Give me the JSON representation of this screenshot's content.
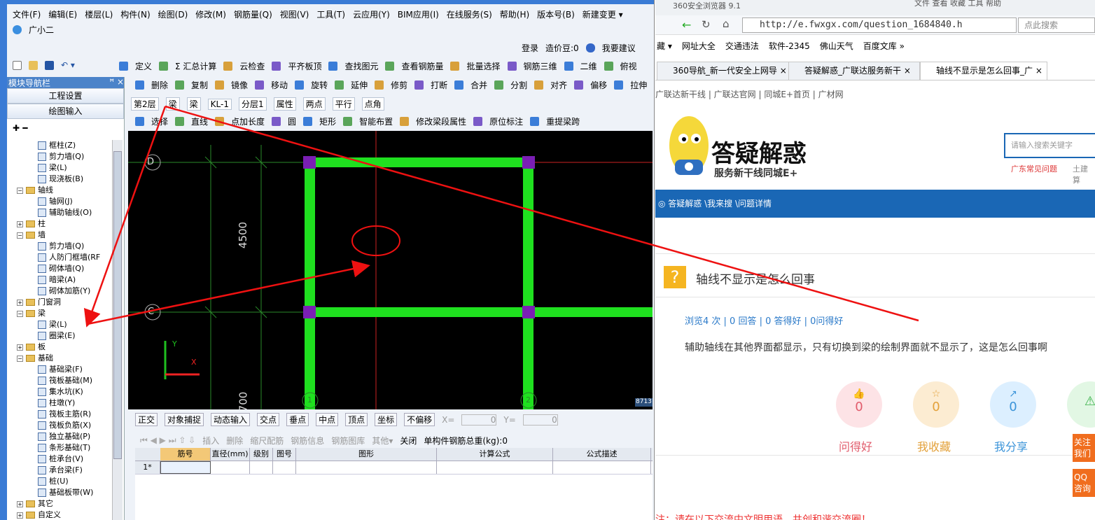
{
  "left": {
    "menu": [
      "文件(F)",
      "编辑(E)",
      "楼层(L)",
      "构件(N)",
      "绘图(D)",
      "修改(M)",
      "钢筋量(Q)",
      "视图(V)",
      "工具(T)",
      "云应用(Y)",
      "BIM应用(I)",
      "在线服务(S)",
      "帮助(H)",
      "版本号(B)",
      "新建变更 ▾"
    ],
    "assistant": "广小二",
    "login": "登录",
    "bean": "造价豆:0",
    "suggest": "我要建议",
    "toolbar1": [
      "定义",
      "Σ 汇总计算",
      "云检查",
      "平齐板顶",
      "查找图元",
      "查看钢筋量",
      "批量选择",
      "钢筋三维",
      "二维",
      "俯视"
    ],
    "toolbar2": [
      "删除",
      "复制",
      "镜像",
      "移动",
      "旋转",
      "延伸",
      "修剪",
      "打断",
      "合并",
      "分割",
      "对齐",
      "偏移",
      "拉伸"
    ],
    "toolbar3": [
      "第2层",
      "梁",
      "梁",
      "KL-1",
      "分层1",
      "属性",
      "两点",
      "平行",
      "点角"
    ],
    "toolbar4": [
      "选择",
      "直线",
      "点加长度",
      "圆",
      "矩形",
      "智能布置",
      "修改梁段属性",
      "原位标注",
      "重提梁跨"
    ],
    "nav_title": "模块导航栏",
    "nav_pin": "ꟸ ×",
    "nav_btn1": "工程设置",
    "nav_btn2": "绘图输入",
    "tree": [
      {
        "t": "框柱(Z)",
        "lv": 2
      },
      {
        "t": "剪力墙(Q)",
        "lv": 2
      },
      {
        "t": "梁(L)",
        "lv": 2
      },
      {
        "t": "现浇板(B)",
        "lv": 2
      },
      {
        "t": "轴线",
        "lv": 1,
        "pm": "−"
      },
      {
        "t": "轴网(J)",
        "lv": 2
      },
      {
        "t": "辅助轴线(O)",
        "lv": 2
      },
      {
        "t": "柱",
        "lv": 1,
        "pm": "+"
      },
      {
        "t": "墙",
        "lv": 1,
        "pm": "−"
      },
      {
        "t": "剪力墙(Q)",
        "lv": 2
      },
      {
        "t": "人防门框墙(RF",
        "lv": 2
      },
      {
        "t": "砌体墙(Q)",
        "lv": 2
      },
      {
        "t": "暗梁(A)",
        "lv": 2
      },
      {
        "t": "砌体加筋(Y)",
        "lv": 2
      },
      {
        "t": "门窗洞",
        "lv": 1,
        "pm": "+"
      },
      {
        "t": "梁",
        "lv": 1,
        "pm": "−"
      },
      {
        "t": "梁(L)",
        "lv": 2
      },
      {
        "t": "圈梁(E)",
        "lv": 2
      },
      {
        "t": "板",
        "lv": 1,
        "pm": "+"
      },
      {
        "t": "基础",
        "lv": 1,
        "pm": "−"
      },
      {
        "t": "基础梁(F)",
        "lv": 2
      },
      {
        "t": "筏板基础(M)",
        "lv": 2
      },
      {
        "t": "集水坑(K)",
        "lv": 2
      },
      {
        "t": "柱墩(Y)",
        "lv": 2
      },
      {
        "t": "筏板主筋(R)",
        "lv": 2
      },
      {
        "t": "筏板负筋(X)",
        "lv": 2
      },
      {
        "t": "独立基础(P)",
        "lv": 2
      },
      {
        "t": "条形基础(T)",
        "lv": 2
      },
      {
        "t": "桩承台(V)",
        "lv": 2
      },
      {
        "t": "承台梁(F)",
        "lv": 2
      },
      {
        "t": "桩(U)",
        "lv": 2
      },
      {
        "t": "基础板带(W)",
        "lv": 2
      },
      {
        "t": "其它",
        "lv": 1,
        "pm": "+"
      },
      {
        "t": "自定义",
        "lv": 1,
        "pm": "+"
      }
    ],
    "axis_D": "D",
    "axis_C": "C",
    "dim1": "4500",
    "dim2": "700",
    "axis_1": "1",
    "axis_2": "2",
    "coord": "8713",
    "yaxis": "Y",
    "xaxis": "X",
    "snap": [
      "正交",
      "对象捕捉",
      "动态输入",
      "交点",
      "垂点",
      "中点",
      "顶点",
      "坐标",
      "不偏移"
    ],
    "snap_x": "X=",
    "snap_xv": "0",
    "snap_y": "Y=",
    "snap_yv": "0",
    "mm": "mm",
    "rebar_bar": [
      "插入",
      "删除",
      "缩尺配筋",
      "钢筋信息",
      "钢筋图库",
      "其他▾",
      "关闭",
      "单构件钢筋总重(kg):0"
    ],
    "grid_cols": [
      "筋号",
      "直径(mm)",
      "级别",
      "图号",
      "图形",
      "计算公式",
      "公式描述"
    ],
    "grid_row": "1*"
  },
  "right": {
    "browser": "360安全浏览器 9.1",
    "menus": "文件  查看  收藏  工具  帮助",
    "url": "http://e.fwxgx.com/question_1684840.h",
    "search_ph": "点此搜索",
    "bookmarks": [
      "藏 ▾",
      "网址大全",
      "交通违法",
      "软件-2345",
      "佛山天气",
      "百度文库 »"
    ],
    "tabs": [
      "360导航_新一代安全上网导",
      "答疑解惑_广联达服务新干",
      "轴线不显示是怎么回事_广"
    ],
    "sitelinks": "广联达新干线  |  广联达官网  |  同城E+首页  |  广材网",
    "logo_title": "答疑解惑",
    "logo_sub": "服务新干线同城E+",
    "search_site_ph": "请输入搜索关键字",
    "hot1": "广东常见问题",
    "hot2": "土建算",
    "crumb": "答疑解惑 \\我来搜 \\问题详情",
    "q_title": "轴线不显示是怎么回事",
    "q_stats": "浏览4 次 | 0 回答 | 0 答得好 | 0问得好",
    "q_body": "辅助轴线在其他界面都显示，只有切换到梁的绘制界面就不显示了，这是怎么回事啊",
    "s1": "0",
    "s1l": "问得好",
    "s2": "0",
    "s2l": "我收藏",
    "s3": "0",
    "s3l": "我分享",
    "follow": "关注我们",
    "qq": "QQ咨询",
    "notice": "注：请在以下交流中文明用语，共创和谐交流圈！"
  },
  "colors": {
    "beam": "#1fe01f",
    "column": "#7a1fb4",
    "arrow": "#e11",
    "blue": "#1a67b5"
  }
}
